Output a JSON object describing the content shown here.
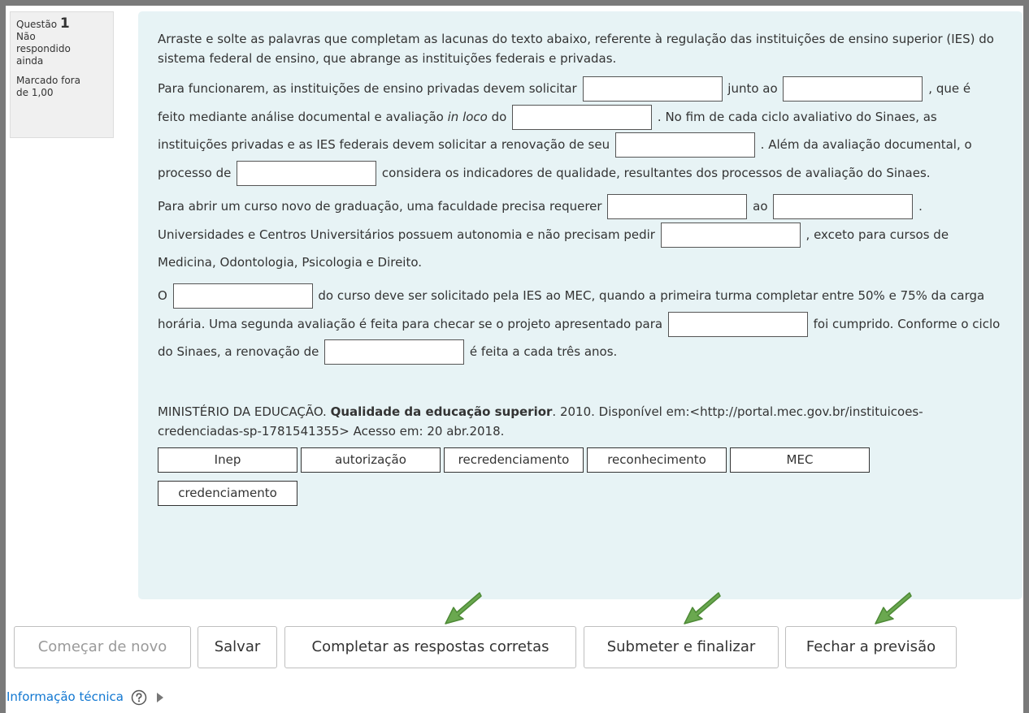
{
  "question_info": {
    "label": "Questão",
    "number": "1",
    "status_line1": "Não",
    "status_line2": "respondido",
    "status_line3": "ainda",
    "mark_line1": "Marcado fora",
    "mark_line2": "de 1,00"
  },
  "question": {
    "intro": "Arraste e solte as palavras que completam as lacunas do texto abaixo, referente à regulação das instituições de ensino superior (IES) do sistema federal de ensino, que abrange as instituições federais e privadas.",
    "p1": {
      "t1": "Para funcionarem, as instituições de ensino privadas devem solicitar",
      "t2": "junto ao",
      "t3": ",",
      "t4": "que é feito mediante análise documental e avaliação",
      "t4_italic": "in loco",
      "t5": "do",
      "t6": ". No fim de cada ciclo avaliativo do Sinaes, as instituições privadas e as IES federais devem solicitar a renovação de seu",
      "t7": ". Além da avaliação documental, o processo de",
      "t8": "considera os indicadores de qualidade, resultantes dos processos de avaliação do Sinaes."
    },
    "p2": {
      "t1": "Para abrir um curso novo de graduação, uma faculdade precisa requerer",
      "t2": "ao",
      "t3": ".",
      "t4": "Universidades e Centros Universitários possuem autonomia e não precisam pedir",
      "t5": ", exceto para cursos de Medicina, Odontologia, Psicologia e Direito."
    },
    "p3": {
      "t1": "O",
      "t2": "do curso deve ser solicitado pela IES ao MEC, quando a primeira turma completar entre 50% e 75% da carga horária. Uma segunda avaliação é feita para checar se o projeto apresentado para",
      "t3": "foi cumprido. Conforme o ciclo do Sinaes, a renovação de",
      "t4": "é feita a cada três anos."
    },
    "citation": {
      "t1": "MINISTÉRIO DA EDUCAÇÃO.",
      "bold": "Qualidade da educação superior",
      "t2": ". 2010. Disponível em:<http://portal.mec.gov.br/instituicoes-credenciadas-sp-1781541355> Acesso em: 20 abr.2018."
    },
    "choices": [
      "Inep",
      "autorização",
      "recredenciamento",
      "reconhecimento",
      "MEC",
      "credenciamento"
    ]
  },
  "buttons": {
    "restart": "Começar de novo",
    "save": "Salvar",
    "fill_correct": "Completar as respostas corretas",
    "submit": "Submeter e finalizar",
    "close_preview": "Fechar a previsão"
  },
  "tech_info": "Informação técnica",
  "colors": {
    "content_bg": "#e7f3f5",
    "link": "#1177d1",
    "arrow": "#6aa84f"
  }
}
